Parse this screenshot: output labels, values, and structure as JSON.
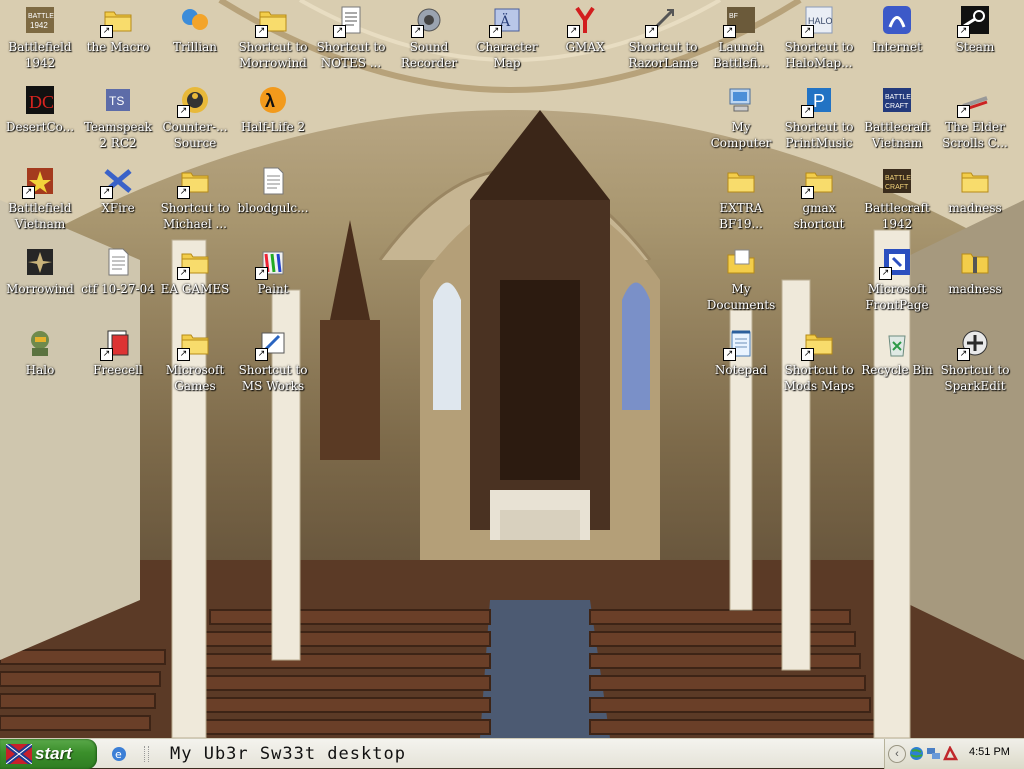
{
  "desktop": {
    "icons": [
      {
        "label": "Battlefield\n1942",
        "icon": "battlefield-1942-icon",
        "shortcut": false
      },
      {
        "label": "the Macro",
        "icon": "folder-icon",
        "shortcut": true
      },
      {
        "label": "Trillian",
        "icon": "trillian-icon",
        "shortcut": false
      },
      {
        "label": "Shortcut to\nMorrowind",
        "icon": "folder-icon",
        "shortcut": true
      },
      {
        "label": "Shortcut to\nNOTES ...",
        "icon": "notes-icon",
        "shortcut": true
      },
      {
        "label": "Sound\nRecorder",
        "icon": "sound-recorder-icon",
        "shortcut": true
      },
      {
        "label": "Character\nMap",
        "icon": "character-map-icon",
        "shortcut": true
      },
      {
        "label": "GMAX",
        "icon": "gmax-icon",
        "shortcut": true
      },
      {
        "label": "Shortcut to\nRazorLame",
        "icon": "razorlame-icon",
        "shortcut": true
      },
      {
        "label": "Launch\nBattlefi...",
        "icon": "battlefield-launch-icon",
        "shortcut": true
      },
      {
        "label": "Shortcut to\nHaloMap...",
        "icon": "halomap-icon",
        "shortcut": true
      },
      {
        "label": "Internet",
        "icon": "internet-icon",
        "shortcut": false
      },
      {
        "label": "Steam",
        "icon": "steam-icon",
        "shortcut": true
      },
      {
        "label": "DesertCo...",
        "icon": "desert-combat-icon",
        "shortcut": false
      },
      {
        "label": "Teamspeak\n2 RC2",
        "icon": "teamspeak-icon",
        "shortcut": false
      },
      {
        "label": "Counter-...\nSource",
        "icon": "counter-strike-icon",
        "shortcut": true
      },
      {
        "label": "Half-Life 2",
        "icon": "half-life-2-icon",
        "shortcut": false
      },
      {
        "label": "My\nComputer",
        "icon": "my-computer-icon",
        "shortcut": false
      },
      {
        "label": "Shortcut to\nPrintMusic",
        "icon": "printmusic-icon",
        "shortcut": true
      },
      {
        "label": "Battlecraft\nVietnam",
        "icon": "battlecraft-vietnam-icon",
        "shortcut": false
      },
      {
        "label": "The Elder\nScrolls C...",
        "icon": "elder-scrolls-icon",
        "shortcut": true
      },
      {
        "label": "Battlefield\nVietnam",
        "icon": "battlefield-vietnam-icon",
        "shortcut": true
      },
      {
        "label": "XFire",
        "icon": "xfire-icon",
        "shortcut": true
      },
      {
        "label": "Shortcut to\nMichael ...",
        "icon": "folder-icon",
        "shortcut": true
      },
      {
        "label": "bloodgulc...",
        "icon": "text-document-icon",
        "shortcut": false
      },
      {
        "label": "EXTRA\nBF19...",
        "icon": "folder-icon",
        "shortcut": false
      },
      {
        "label": "gmax\nshortcut",
        "icon": "folder-icon",
        "shortcut": true
      },
      {
        "label": "Battlecraft\n1942",
        "icon": "battlecraft-1942-icon",
        "shortcut": false
      },
      {
        "label": "madness",
        "icon": "folder-icon",
        "shortcut": false
      },
      {
        "label": "Morrowind",
        "icon": "morrowind-icon",
        "shortcut": false
      },
      {
        "label": "ctf 10-27-04",
        "icon": "text-document-icon",
        "shortcut": false
      },
      {
        "label": "EA GAMES",
        "icon": "folder-icon",
        "shortcut": true
      },
      {
        "label": "Paint",
        "icon": "paint-icon",
        "shortcut": true
      },
      {
        "label": "My\nDocuments",
        "icon": "my-documents-icon",
        "shortcut": false
      },
      {
        "label": "Microsoft\nFrontPage",
        "icon": "frontpage-icon",
        "shortcut": true
      },
      {
        "label": "madness",
        "icon": "zip-folder-icon",
        "shortcut": false
      },
      {
        "label": "Halo",
        "icon": "halo-icon",
        "shortcut": false
      },
      {
        "label": "Freecell",
        "icon": "freecell-icon",
        "shortcut": true
      },
      {
        "label": "Microsoft\nGames",
        "icon": "folder-icon",
        "shortcut": true
      },
      {
        "label": "Shortcut to\nMS Works",
        "icon": "ms-works-icon",
        "shortcut": true
      },
      {
        "label": "Notepad",
        "icon": "notepad-icon",
        "shortcut": true
      },
      {
        "label": "Shortcut to\nMods Maps",
        "icon": "folder-icon",
        "shortcut": true
      },
      {
        "label": "Recycle Bin",
        "icon": "recycle-bin-icon",
        "shortcut": false
      },
      {
        "label": "Shortcut to\nSparkEdit",
        "icon": "sparkedit-icon",
        "shortcut": true
      }
    ]
  },
  "taskbar": {
    "start_label": "start",
    "title_text": "My Ub3r Sw33t desktop",
    "clock": "4:51 PM",
    "colors": {
      "start_green": "#3b8f2b",
      "taskbar_bg": "#ece9d8"
    }
  }
}
